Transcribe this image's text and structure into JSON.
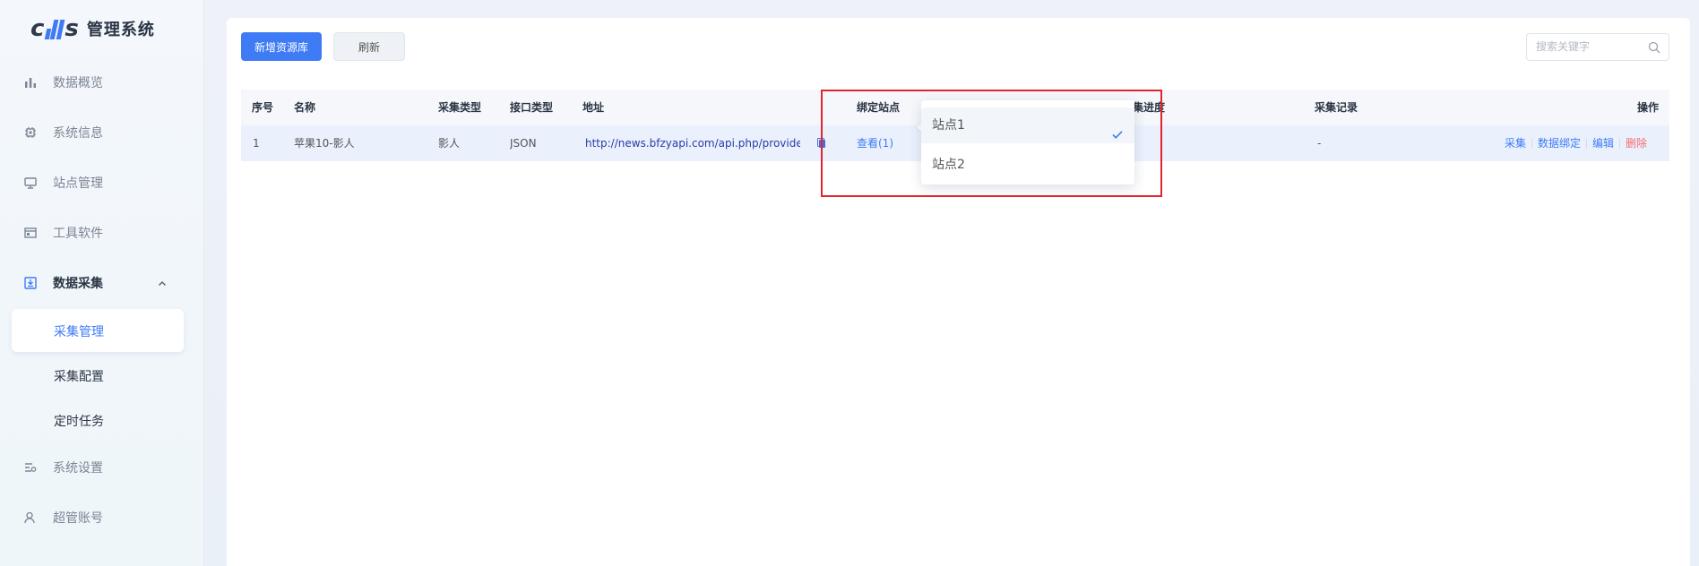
{
  "brand": {
    "logo_text_left": "c",
    "logo_text_right": "s",
    "title": "管理系统"
  },
  "sidebar": {
    "items": [
      {
        "label": "数据概览",
        "icon": "bar-chart-icon"
      },
      {
        "label": "系统信息",
        "icon": "chip-icon"
      },
      {
        "label": "站点管理",
        "icon": "monitor-icon"
      },
      {
        "label": "工具软件",
        "icon": "window-icon"
      },
      {
        "label": "数据采集",
        "icon": "download-box-icon"
      },
      {
        "label": "系统设置",
        "icon": "settings-list-icon"
      },
      {
        "label": "超管账号",
        "icon": "user-icon"
      }
    ],
    "sub_items": [
      {
        "label": "采集管理"
      },
      {
        "label": "采集配置"
      },
      {
        "label": "定时任务"
      }
    ]
  },
  "toolbar": {
    "add_label": "新增资源库",
    "refresh_label": "刷新",
    "search_placeholder": "搜索关键字"
  },
  "table": {
    "headers": {
      "index": "序号",
      "name": "名称",
      "collect_type": "采集类型",
      "api_type": "接口类型",
      "address": "地址",
      "bound_sites": "绑定站点",
      "progress": "采集进度",
      "progress_visible": "集进度",
      "records": "采集记录",
      "actions": "操作"
    },
    "rows": [
      {
        "index": "1",
        "name": "苹果10-影人",
        "collect_type": "影人",
        "api_type": "JSON",
        "address": "http://news.bfzyapi.com/api.php/provide/",
        "bound_sites_link": "查看(1)",
        "records": "-",
        "actions": {
          "collect": "采集",
          "bind": "数据绑定",
          "edit": "编辑",
          "delete": "删除"
        }
      }
    ]
  },
  "dropdown": {
    "options": [
      {
        "label": "站点1",
        "selected": true
      },
      {
        "label": "站点2",
        "selected": false
      }
    ]
  },
  "colors": {
    "primary": "#3f7bf5",
    "danger": "#f56c6c",
    "highlight_border": "#e0252e",
    "row_highlight": "#eaf1fd"
  }
}
